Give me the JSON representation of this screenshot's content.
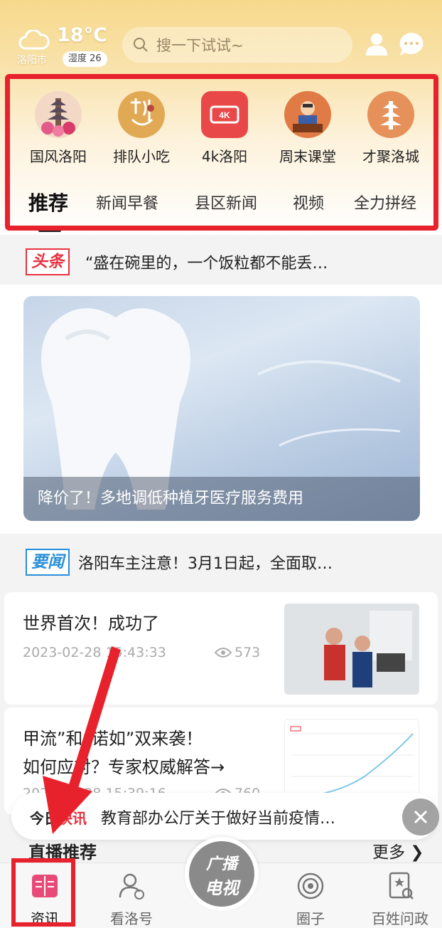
{
  "weather": {
    "temperature": "18°C",
    "city": "洛阳市",
    "humidity": "湿度 26"
  },
  "search": {
    "placeholder": "搜一下试试~"
  },
  "quick_links": [
    {
      "label": "国风洛阳",
      "icon": "pagoda-flowers-icon"
    },
    {
      "label": "排队小吃",
      "icon": "calligraphy-snack-icon"
    },
    {
      "label": "4k洛阳",
      "icon": "4k-icon"
    },
    {
      "label": "周末课堂",
      "icon": "teacher-icon"
    },
    {
      "label": "才聚洛城",
      "icon": "tower-icon"
    }
  ],
  "tabs": [
    "推荐",
    "新闻早餐",
    "县区新闻",
    "视频",
    "全力拼经"
  ],
  "headline": {
    "badge": "头条",
    "text": "“盛在碗里的，一个饭粒都不能丢…"
  },
  "hero": {
    "caption": "降价了！多地调低种植牙医疗服务费用"
  },
  "important": {
    "badge": "要闻",
    "text": "洛阳车主注意！3月1日起，全面取…"
  },
  "articles": [
    {
      "title": "世界首次！成功了",
      "date": "2023-02-28 15:43:33",
      "views": "573"
    },
    {
      "title_line1": "甲流”和“诺如”双来袭！",
      "title_line2": "如何应对？专家权威解答→",
      "date": "2023-02-28 15:39:16",
      "views": "760"
    }
  ],
  "ticker": {
    "tag_a": "今日",
    "tag_b": "快讯",
    "text": "教育部办公厅关于做好当前疫情…"
  },
  "live": {
    "title": "直播推荐",
    "more": "更多"
  },
  "bottom_nav": [
    {
      "label": "资讯",
      "icon": "news-book-icon"
    },
    {
      "label": "看洛号",
      "icon": "user-badge-icon"
    },
    {
      "label": "圈子",
      "icon": "circle-icon"
    },
    {
      "label": "百姓问政",
      "icon": "inquiry-icon"
    }
  ],
  "center_button": {
    "line1": "广播",
    "line2": "电视"
  },
  "colors": {
    "annotation_red": "#e8222d",
    "headline_red": "#e8323f",
    "important_blue": "#2a8ed8"
  }
}
